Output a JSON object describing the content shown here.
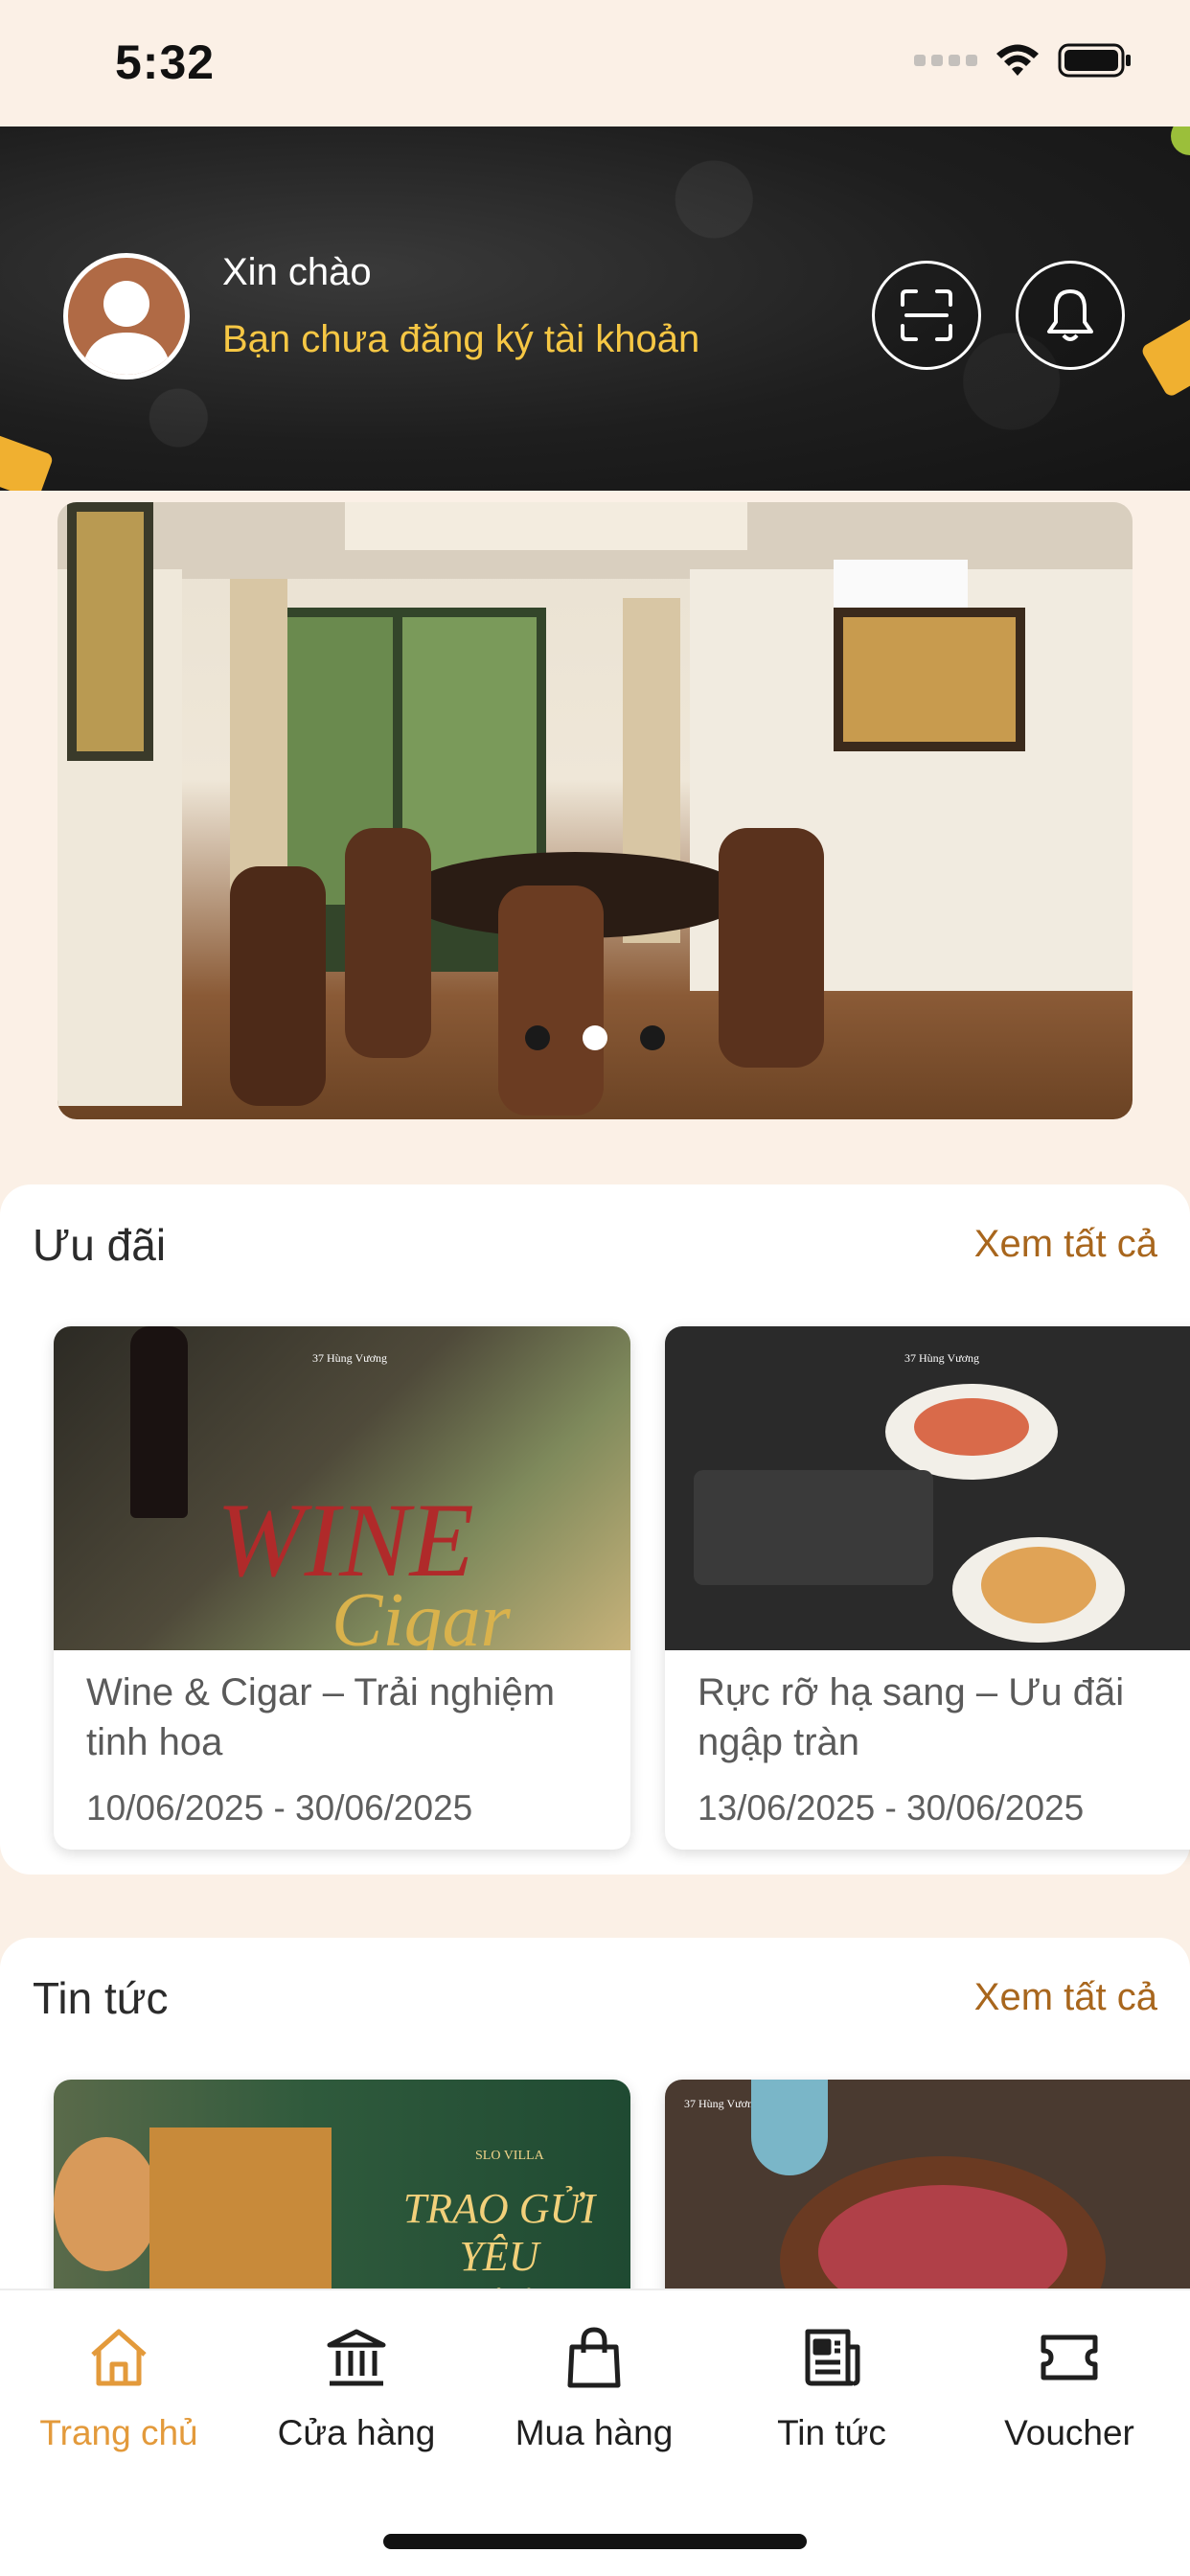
{
  "status_bar": {
    "time": "5:32"
  },
  "header": {
    "greeting": "Xin chào",
    "register_prompt": "Bạn chưa đăng ký tài khoản",
    "avatar_icon": "user-avatar-icon",
    "scan_icon": "scan-icon",
    "bell_icon": "bell-icon"
  },
  "banner": {
    "slide_count": 3,
    "active_index": 1
  },
  "offers": {
    "title": "Ưu đãi",
    "see_all": "Xem tất cả",
    "items": [
      {
        "title": "Wine & Cigar – Trải nghiệm tinh hoa",
        "dates": "10/06/2025 - 30/06/2025",
        "image_text": "WINE",
        "image_text_2": "Cigar",
        "image_brand": "37 Hùng Vương"
      },
      {
        "title": "Rực rỡ hạ sang – Ưu đãi ngập tràn",
        "dates": "13/06/2025 - 30/06/2025",
        "image_brand": "37 Hùng Vương"
      }
    ]
  },
  "news": {
    "title": "Tin tức",
    "see_all": "Xem tất cả",
    "items": [
      {
        "image_text": "TRAO GỬI YÊU THƯƠNG",
        "image_brand": "SLO VILLA"
      },
      {
        "image_brand": "37 Hùng Vương"
      }
    ]
  },
  "bottom_nav": {
    "items": [
      {
        "label": "Trang chủ",
        "icon": "home-icon",
        "active": true
      },
      {
        "label": "Cửa hàng",
        "icon": "store-icon",
        "active": false
      },
      {
        "label": "Mua hàng",
        "icon": "shopping-bag-icon",
        "active": false
      },
      {
        "label": "Tin tức",
        "icon": "newspaper-icon",
        "active": false
      },
      {
        "label": "Voucher",
        "icon": "ticket-icon",
        "active": false
      }
    ]
  },
  "colors": {
    "accent": "#e39a3b",
    "link": "#a8661d",
    "highlight": "#f6c744",
    "page_bg": "#fbf0e6"
  }
}
